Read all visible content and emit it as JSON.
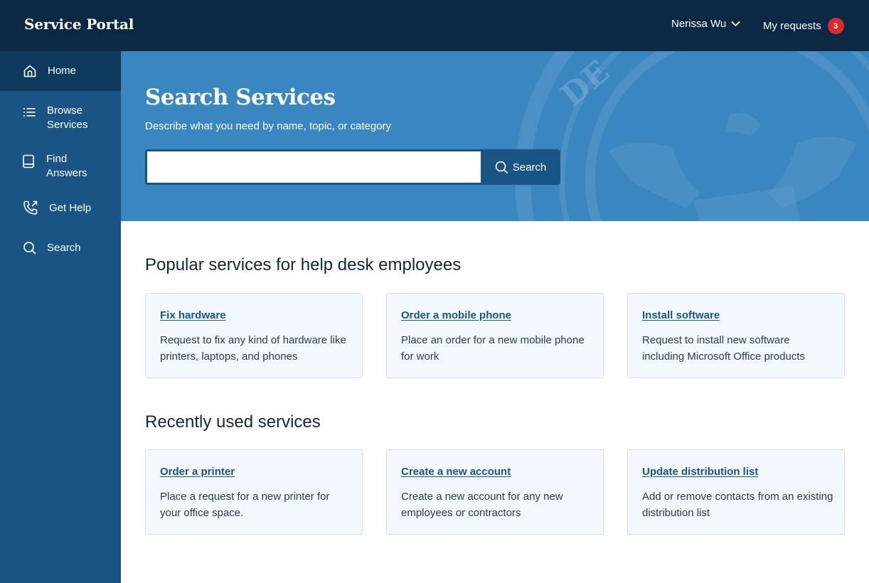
{
  "header": {
    "brand": "Service Portal",
    "user_name": "Nerissa Wu",
    "requests_label": "My requests",
    "requests_count": "3"
  },
  "sidebar": {
    "items": [
      {
        "label": "Home",
        "icon": "home-icon",
        "active": true
      },
      {
        "label": "Browse Services",
        "icon": "list-icon",
        "active": false
      },
      {
        "label": "Find Answers",
        "icon": "book-icon",
        "active": false
      },
      {
        "label": "Get Help",
        "icon": "phone-icon",
        "active": false
      },
      {
        "label": "Search",
        "icon": "search-icon",
        "active": false
      }
    ]
  },
  "hero": {
    "title": "Search Services",
    "subtitle": "Describe what you need by name, topic, or category",
    "search_value": "",
    "search_button": "Search"
  },
  "popular": {
    "title": "Popular services for help desk employees",
    "cards": [
      {
        "title": "Fix hardware",
        "description": "Request to fix any kind of hardware like printers, laptops, and phones"
      },
      {
        "title": "Order a mobile phone",
        "description": "Place an order for a new mobile phone for work"
      },
      {
        "title": "Install software",
        "description": "Request to install new software including Microsoft Office products"
      }
    ]
  },
  "recent": {
    "title": "Recently used services",
    "cards": [
      {
        "title": "Order a printer",
        "description": "Place a request for a new printer for your office space."
      },
      {
        "title": "Create a new account",
        "description": "Create a new account for any new employees or contractors"
      },
      {
        "title": "Update distribution list",
        "description": "Add or remove contacts from an existing distribution list"
      }
    ]
  },
  "colors": {
    "topbar": "#0b2844",
    "sidebar": "#1a5485",
    "sidebar_active": "#0f3a5f",
    "hero": "#3a86c0",
    "badge": "#d92b2b",
    "link": "#1a5485",
    "card_bg": "#f2f8fd"
  }
}
